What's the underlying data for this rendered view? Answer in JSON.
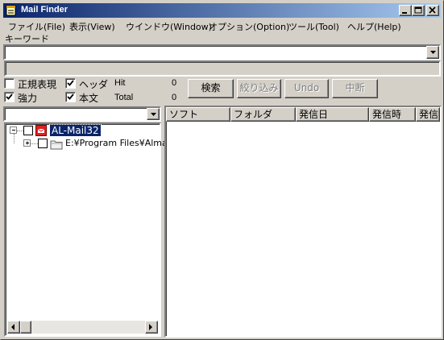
{
  "window": {
    "title": "Mail Finder",
    "controls": [
      "minimize",
      "maximize",
      "close"
    ]
  },
  "menu": [
    {
      "label": "ファイル(File)"
    },
    {
      "label": "表示(View)"
    },
    {
      "label": "ウインドウ(Window)"
    },
    {
      "label": "オプション(Option)"
    },
    {
      "label": "ツール(Tool)"
    },
    {
      "label": "ヘルプ(Help)"
    }
  ],
  "search": {
    "keyword_label": "キーワード",
    "keyword_value": "",
    "readout": ""
  },
  "options": {
    "regex": {
      "label": "正規表現",
      "checked": false
    },
    "header": {
      "label": "ヘッダ",
      "checked": true
    },
    "strong": {
      "label": "強力",
      "checked": true
    },
    "body": {
      "label": "本文",
      "checked": true
    }
  },
  "stats": {
    "hit_label": "Hit",
    "hit_value": "0",
    "total_label": "Total",
    "total_value": "0"
  },
  "buttons": {
    "search": {
      "label": "検索",
      "enabled": true
    },
    "narrow": {
      "label": "絞り込み",
      "enabled": false
    },
    "undo": {
      "label": "Undo",
      "enabled": false
    },
    "abort": {
      "label": "中断",
      "enabled": false
    }
  },
  "tree": {
    "combo_value": "",
    "root": {
      "label": "AL-Mail32",
      "expanded": true,
      "checked": false
    },
    "child": {
      "label": "E:¥Program Files¥Alma",
      "expanded": false,
      "checked": false
    }
  },
  "list": {
    "columns": [
      "ソフト",
      "フォルダ",
      "発信日",
      "発信時",
      "発信者"
    ]
  },
  "colors": {
    "title_start": "#0a246a",
    "title_end": "#a6caf0",
    "face": "#d4d0c8",
    "mail_icon": "#e02020"
  }
}
